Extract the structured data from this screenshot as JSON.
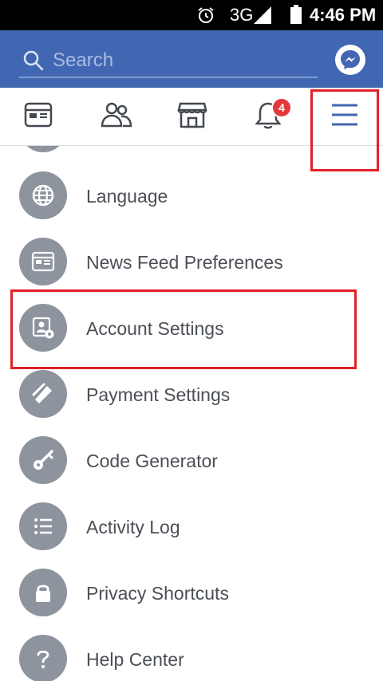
{
  "status_bar": {
    "network": "3G",
    "time": "4:46 PM"
  },
  "header": {
    "search_placeholder": "Search"
  },
  "tabs": {
    "notification_count": "4",
    "items": [
      "news-feed",
      "friends",
      "marketplace",
      "notifications",
      "menu"
    ]
  },
  "menu": {
    "items": [
      {
        "label": "Language",
        "icon": "globe-icon"
      },
      {
        "label": "News Feed Preferences",
        "icon": "news-feed-icon"
      },
      {
        "label": "Account Settings",
        "icon": "account-settings-icon"
      },
      {
        "label": "Payment Settings",
        "icon": "payment-tag-icon"
      },
      {
        "label": "Code Generator",
        "icon": "key-icon"
      },
      {
        "label": "Activity Log",
        "icon": "list-icon"
      },
      {
        "label": "Privacy Shortcuts",
        "icon": "lock-icon"
      },
      {
        "label": "Help Center",
        "icon": "question-icon"
      }
    ]
  },
  "colors": {
    "brand_blue": "#4267b2",
    "icon_gray": "#8d949e",
    "highlight_red": "#e2202a",
    "badge_red": "#e4383c"
  }
}
